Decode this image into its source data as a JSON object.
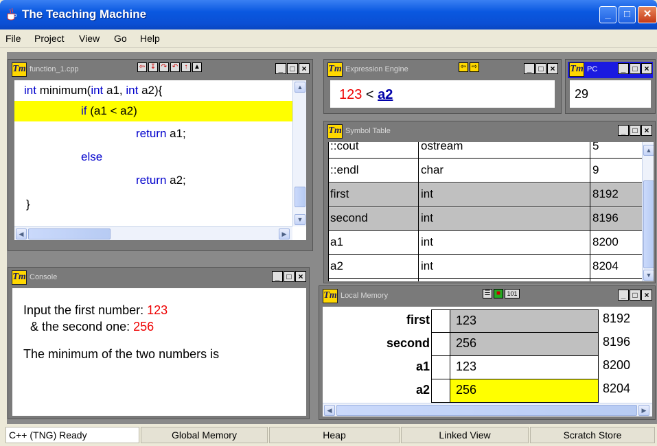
{
  "window": {
    "title": "The Teaching Machine"
  },
  "menu": [
    "File",
    "Project",
    "View",
    "Go",
    "Help"
  ],
  "source": {
    "title": "function_1.cpp",
    "lines": [
      {
        "indent": "  ",
        "parts": [
          {
            "t": "int",
            "k": 1
          },
          {
            "t": " minimum(",
            "k": 0
          },
          {
            "t": "int",
            "k": 1
          },
          {
            "t": " a1, ",
            "k": 0
          },
          {
            "t": "int",
            "k": 1
          },
          {
            "t": " a2){",
            "k": 0
          }
        ]
      },
      {
        "indent": "",
        "parts": [
          {
            "t": "if",
            "k": 1
          },
          {
            "t": " (a1 < a2)",
            "k": 0
          }
        ]
      },
      {
        "indent": "",
        "parts": [
          {
            "t": "return",
            "k": 1
          },
          {
            "t": " a1;",
            "k": 0
          }
        ]
      },
      {
        "indent": "",
        "parts": [
          {
            "t": "else",
            "k": 1
          }
        ]
      },
      {
        "indent": "",
        "parts": [
          {
            "t": "return",
            "k": 1
          },
          {
            "t": " a2;",
            "k": 0
          }
        ]
      },
      {
        "indent": "",
        "parts": [
          {
            "t": "}",
            "k": 0
          }
        ]
      }
    ]
  },
  "expression": {
    "title": "Expression Engine",
    "left": "123",
    "op": " < ",
    "right": "a2"
  },
  "pc": {
    "title": "PC",
    "value": "29"
  },
  "symbols": {
    "title": "Symbol Table",
    "rows": [
      {
        "name": "::cout",
        "type": "ostream",
        "addr": "5"
      },
      {
        "name": "::endl",
        "type": "char",
        "addr": "9"
      },
      {
        "name": "first",
        "type": "int",
        "addr": "8192"
      },
      {
        "name": "second",
        "type": "int",
        "addr": "8196"
      },
      {
        "name": "a1",
        "type": "int",
        "addr": "8200"
      },
      {
        "name": "a2",
        "type": "int",
        "addr": "8204"
      }
    ]
  },
  "console": {
    "title": "Console",
    "line1": "Input the first number: ",
    "val1": "123",
    "line2": "  & the second one: ",
    "val2": "256",
    "line3": "The minimum of the two numbers is"
  },
  "memory": {
    "title": "Local Memory",
    "rows": [
      {
        "name": "first",
        "value": "123",
        "addr": "8192"
      },
      {
        "name": "second",
        "value": "256",
        "addr": "8196"
      },
      {
        "name": "a1",
        "value": "123",
        "addr": "8200"
      },
      {
        "name": "a2",
        "value": "256",
        "addr": "8204"
      }
    ]
  },
  "status": {
    "ready": "C++ (TNG) Ready",
    "tabs": [
      "Global Memory",
      "Heap",
      "Linked View",
      "Scratch Store"
    ]
  },
  "colors": {
    "highlight": "#ffff00",
    "keyword": "#0000cc",
    "value": "#ee0000"
  }
}
